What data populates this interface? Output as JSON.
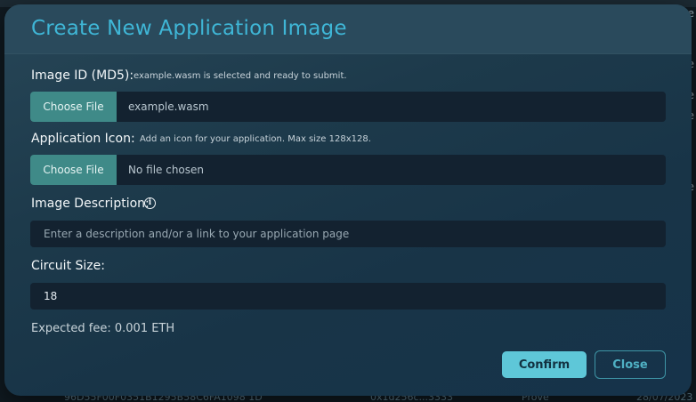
{
  "background": {
    "right_edge_fragments": [
      "ee",
      "ee",
      "e",
      "e",
      "e"
    ],
    "table_row": {
      "hash": "96D55F00F0351B1295B58C6FA1098 1D",
      "address": "0x1d256c...3333",
      "action": "Prove",
      "date": "28/07/2023"
    }
  },
  "modal": {
    "title": "Create New Application Image",
    "image_id": {
      "label": "Image ID (MD5):",
      "hint": "example.wasm is selected and ready to submit.",
      "button": "Choose File",
      "file_name": "example.wasm"
    },
    "app_icon": {
      "label": "Application Icon:",
      "hint": "Add an icon for your application. Max size 128x128.",
      "button": "Choose File",
      "file_name": "No file chosen"
    },
    "description": {
      "label": "Image Description:",
      "info_icon": "i",
      "placeholder": "Enter a description and/or a link to your application page"
    },
    "circuit_size": {
      "label": "Circuit Size:",
      "value": "18"
    },
    "fee_text": "Expected fee: 0.001 ETH",
    "confirm_label": "Confirm",
    "close_label": "Close"
  },
  "colors": {
    "title": "#3fb6d6",
    "file_button": "#3f8a88",
    "confirm_button": "#5ec7d8",
    "close_border": "#3e95a6"
  }
}
